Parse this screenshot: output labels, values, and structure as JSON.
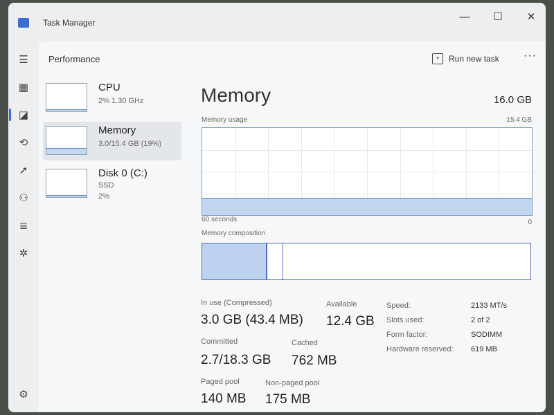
{
  "window": {
    "title": "Task Manager"
  },
  "nav": {
    "items": [
      {
        "name": "hamburger-menu-icon",
        "glyph": "☰"
      },
      {
        "name": "processes-icon",
        "glyph": "▦"
      },
      {
        "name": "performance-icon",
        "glyph": "◪"
      },
      {
        "name": "app-history-icon",
        "glyph": "⟲"
      },
      {
        "name": "startup-apps-icon",
        "glyph": "➚"
      },
      {
        "name": "users-icon",
        "glyph": "⚇"
      },
      {
        "name": "details-icon",
        "glyph": "≣"
      },
      {
        "name": "services-icon",
        "glyph": "✲"
      }
    ],
    "settings_glyph": "⚙"
  },
  "header": {
    "title": "Performance",
    "run_new_task": "Run new task",
    "more": "···"
  },
  "devices": [
    {
      "name": "CPU",
      "sub1": "2%  1.30 GHz",
      "sub2": "",
      "usage": 0.02
    },
    {
      "name": "Memory",
      "sub1": "3.0/15.4 GB (19%)",
      "sub2": "",
      "usage": 0.19
    },
    {
      "name": "Disk 0 (C:)",
      "sub1": "SSD",
      "sub2": "2%",
      "usage": 0.02
    }
  ],
  "memory": {
    "title": "Memory",
    "total": "16.0 GB",
    "usage_label": "Memory usage",
    "usage_max": "15.4 GB",
    "usage_fraction": 0.19,
    "time_left": "60 seconds",
    "time_right": "0",
    "composition_label": "Memory composition",
    "composition": {
      "in_use": 0.195,
      "modified": 0.046
    },
    "stats": {
      "in_use_label": "In use (Compressed)",
      "in_use_value": "3.0 GB (43.4 MB)",
      "available_label": "Available",
      "available_value": "12.4 GB",
      "committed_label": "Committed",
      "committed_value": "2.7/18.3 GB",
      "cached_label": "Cached",
      "cached_value": "762 MB",
      "paged_label": "Paged pool",
      "paged_value": "140 MB",
      "nonpaged_label": "Non-paged pool",
      "nonpaged_value": "175 MB"
    },
    "props": {
      "speed_label": "Speed:",
      "speed_value": "2133 MT/s",
      "slots_label": "Slots used:",
      "slots_value": "2 of 2",
      "form_label": "Form factor:",
      "form_value": "SODIMM",
      "hw_label": "Hardware reserved:",
      "hw_value": "619 MB"
    }
  }
}
